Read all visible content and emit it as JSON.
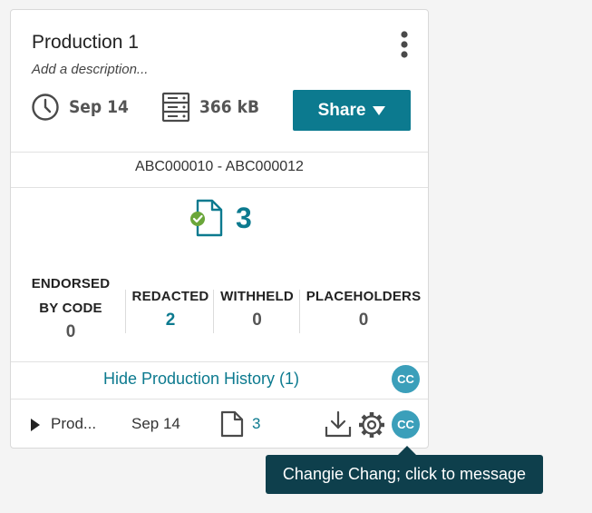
{
  "card": {
    "title": "Production 1",
    "description_placeholder": "Add a description...",
    "date": "Sep 14",
    "size": "366 kB",
    "share_label": "Share",
    "bates_range": "ABC000010 - ABC000012",
    "document_count": "3",
    "stats": {
      "endorsed": {
        "label_line1": "ENDORSED",
        "label_line2": "BY CODE",
        "value": "0"
      },
      "redacted": {
        "label": "REDACTED",
        "value": "2"
      },
      "withheld": {
        "label": "WITHHELD",
        "value": "0"
      },
      "placeholders": {
        "label": "PLACEHOLDERS",
        "value": "0"
      }
    },
    "history_link": "Hide Production History (1)",
    "history_avatar": "CC",
    "history_row": {
      "name": "Prod...",
      "date": "Sep 14",
      "doc_count": "3",
      "avatar": "CC"
    }
  },
  "tooltip": {
    "text": "Changie Chang; click to message"
  },
  "colors": {
    "accent": "#0c7a8f",
    "avatar": "#3b9fba",
    "tooltip_bg": "#0e3f4c",
    "check": "#6aa63a"
  },
  "icons": [
    "kebab-menu-icon",
    "clock-icon",
    "server-icon",
    "caret-down-icon",
    "document-check-icon",
    "expand-arrow-icon",
    "document-icon",
    "download-icon",
    "gear-icon"
  ]
}
